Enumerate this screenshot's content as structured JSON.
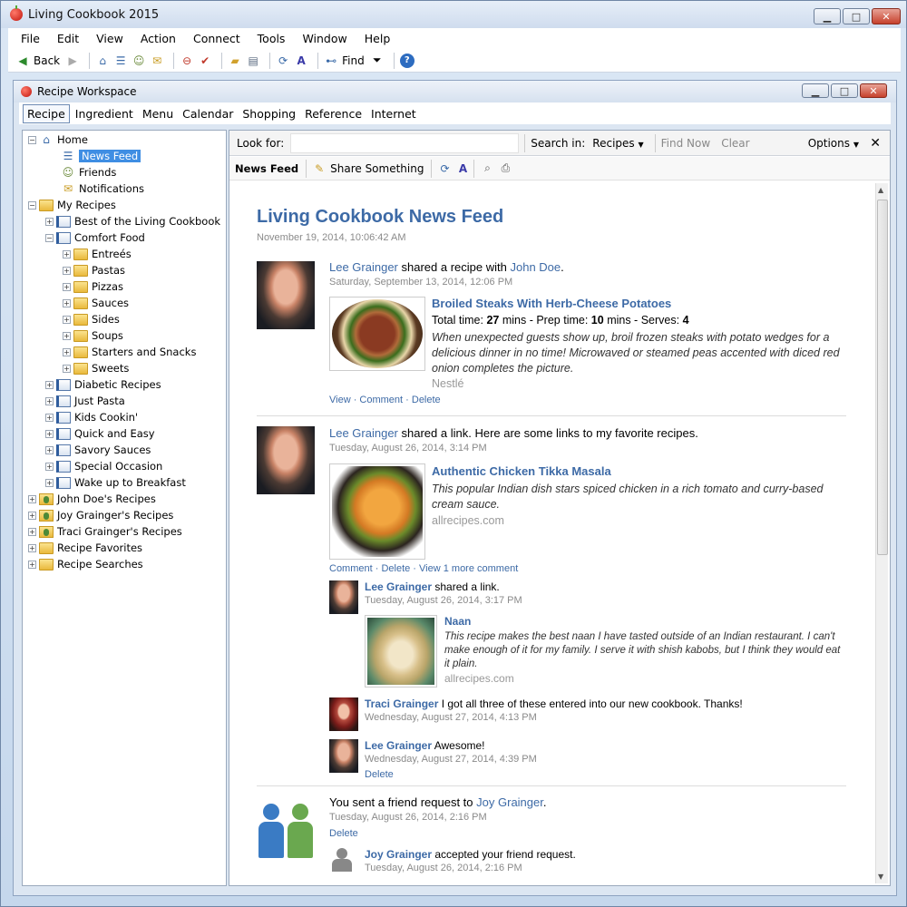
{
  "app": {
    "title": "Living Cookbook 2015"
  },
  "window_buttons": {
    "min": "▁",
    "max": "□",
    "close": "✕"
  },
  "menu": [
    "File",
    "Edit",
    "View",
    "Action",
    "Connect",
    "Tools",
    "Window",
    "Help"
  ],
  "toolbar": {
    "back": "Back",
    "find": "Find"
  },
  "workspace": {
    "title": "Recipe Workspace",
    "tabs": [
      "Recipe",
      "Ingredient",
      "Menu",
      "Calendar",
      "Shopping",
      "Reference",
      "Internet"
    ]
  },
  "tree": {
    "home": "Home",
    "news_feed": "News Feed",
    "friends": "Friends",
    "notifications": "Notifications",
    "my_recipes": "My Recipes",
    "best": "Best of the Living Cookbook",
    "comfort": "Comfort Food",
    "comfort_children": [
      "Entreés",
      "Pastas",
      "Pizzas",
      "Sauces",
      "Sides",
      "Soups",
      "Starters and Snacks",
      "Sweets"
    ],
    "books": [
      "Diabetic Recipes",
      "Just Pasta",
      "Kids Cookin'",
      "Quick and Easy",
      "Savory Sauces",
      "Special Occasion",
      "Wake up to Breakfast"
    ],
    "others": [
      "John Doe's Recipes",
      "Joy Grainger's Recipes",
      "Traci Grainger's Recipes",
      "Recipe Favorites",
      "Recipe Searches"
    ]
  },
  "search": {
    "look_for": "Look for:",
    "search_in": "Search in:",
    "scope": "Recipes",
    "find_now": "Find Now",
    "clear": "Clear",
    "options": "Options"
  },
  "subbar": {
    "news_feed": "News Feed",
    "share": "Share Something"
  },
  "feed": {
    "title": "Living Cookbook News Feed",
    "date": "November 19, 2014, 10:06:42 AM",
    "post1": {
      "author": "Lee Grainger",
      "action": "shared a recipe with",
      "target": "John Doe",
      "date": "Saturday, September 13, 2014, 12:06 PM",
      "recipe_title": "Broiled Steaks With Herb-Cheese Potatoes",
      "total_label": "Total time:",
      "total_val": "27",
      "prep_label": "mins - Prep time:",
      "prep_val": "10",
      "serves_label": "mins - Serves:",
      "serves_val": "4",
      "desc": "When unexpected guests show up, broil frozen steaks with potato wedges for a delicious dinner in no time! Microwaved or steamed peas accented with diced red onion completes the picture.",
      "source": "Nestlé",
      "links": "View · Comment · Delete"
    },
    "post2": {
      "author": "Lee Grainger",
      "text": "shared a link. Here are some links to my favorite recipes.",
      "date": "Tuesday, August 26, 2014, 3:14 PM",
      "recipe_title": "Authentic Chicken Tikka Masala",
      "desc": "This popular Indian dish stars spiced chicken in a rich tomato and curry-based cream sauce.",
      "source": "allrecipes.com",
      "links": "Comment · Delete · View 1 more comment",
      "sub1": {
        "author": "Lee Grainger",
        "text": "shared a link.",
        "date": "Tuesday, August 26, 2014, 3:17 PM",
        "title": "Naan",
        "desc": "This recipe makes the best naan I have tasted outside of an Indian restaurant. I can't make enough of it for my family. I serve it with shish kabobs, but I think they would eat it plain.",
        "source": "allrecipes.com"
      },
      "sub2": {
        "author": "Traci Grainger",
        "text": "I got all three of these entered into our new cookbook. Thanks!",
        "date": "Wednesday, August 27, 2014, 4:13 PM"
      },
      "sub3": {
        "author": "Lee Grainger",
        "text": "Awesome!",
        "date": "Wednesday, August 27, 2014, 4:39 PM",
        "delete": "Delete"
      }
    },
    "post3": {
      "text": "You sent a friend request to",
      "target": "Joy Grainger",
      "date": "Tuesday, August 26, 2014, 2:16 PM",
      "delete": "Delete",
      "sub_author": "Joy Grainger",
      "sub_text": "accepted your friend request.",
      "sub_date": "Tuesday, August 26, 2014, 2:16 PM"
    }
  }
}
